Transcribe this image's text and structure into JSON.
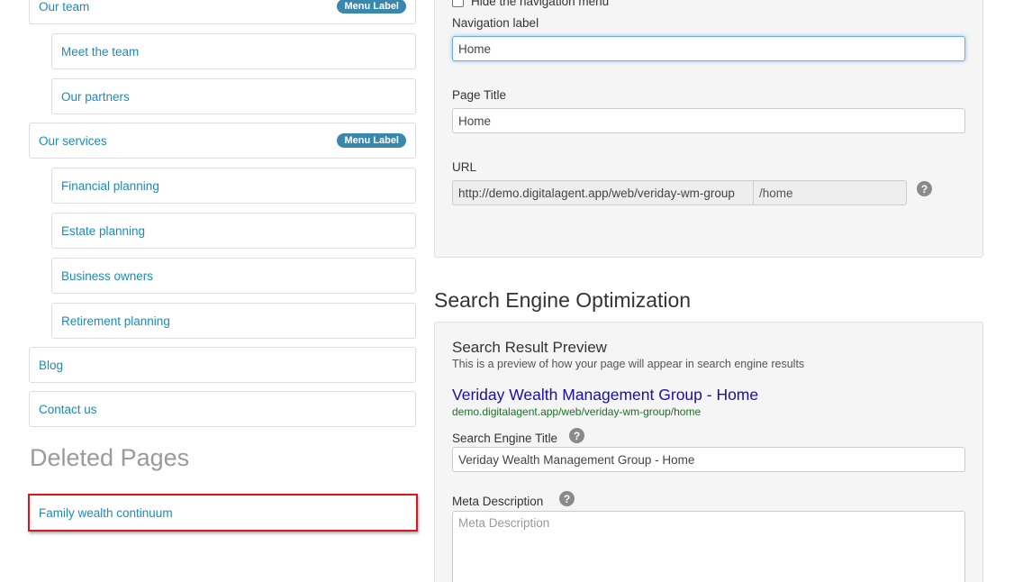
{
  "page_tree": {
    "menu_badge": "Menu Label",
    "items": [
      {
        "label": "Our team"
      },
      {
        "label": "Meet the team"
      },
      {
        "label": "Our partners"
      },
      {
        "label": "Our services"
      },
      {
        "label": "Financial planning"
      },
      {
        "label": "Estate planning"
      },
      {
        "label": "Business owners"
      },
      {
        "label": "Retirement planning"
      },
      {
        "label": "Blog"
      },
      {
        "label": "Contact us"
      }
    ]
  },
  "deleted_pages": {
    "heading": "Deleted Pages",
    "items": [
      {
        "label": "Family wealth continuum"
      }
    ]
  },
  "settings": {
    "hide_nav_label": "Hide the navigation menu",
    "nav_label": {
      "label": "Navigation label",
      "value": "Home"
    },
    "page_title": {
      "label": "Page Title",
      "value": "Home"
    },
    "url": {
      "label": "URL",
      "prefix": "http://demo.digitalagent.app/web/veriday-wm-group",
      "slug": "/home"
    },
    "help_glyph": "?"
  },
  "seo": {
    "heading": "Search Engine Optimization",
    "preview": {
      "heading": "Search Result Preview",
      "description": "This is a preview of how your page will appear in search engine results",
      "title": "Veriday Wealth Management Group - Home",
      "url": "demo.digitalagent.app/web/veriday-wm-group/home"
    },
    "engine_title": {
      "label": "Search Engine Title",
      "value": "Veriday Wealth Management Group - Home"
    },
    "meta_description": {
      "label": "Meta Description",
      "placeholder": "Meta Description"
    }
  },
  "colors": {
    "link": "#1a8bb9",
    "badge": "#3a87ad",
    "deleted_highlight": "#d9181d",
    "preview_title": "#1a0dab",
    "preview_url": "#1e6e25"
  }
}
